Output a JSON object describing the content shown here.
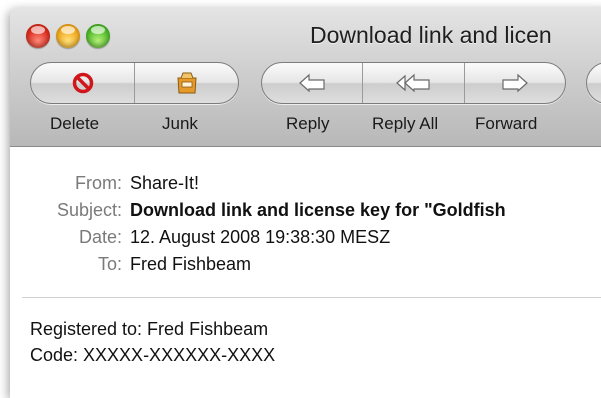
{
  "window": {
    "title": "Download link and licen"
  },
  "toolbar": {
    "delete_label": "Delete",
    "junk_label": "Junk",
    "reply_label": "Reply",
    "reply_all_label": "Reply All",
    "forward_label": "Forward"
  },
  "headers": {
    "from_key": "From:",
    "from_value": "Share-It!",
    "subject_key": "Subject:",
    "subject_value": "Download link and license key for \"Goldfish",
    "date_key": "Date:",
    "date_value": "12. August 2008 19:38:30 MESZ",
    "to_key": "To:",
    "to_value": "Fred Fishbeam"
  },
  "body": {
    "line1": "Registered to: Fred Fishbeam",
    "line2": "Code: XXXXX-XXXXXX-XXXX"
  },
  "colors": {
    "delete_icon": "#d0161a",
    "junk_icon": "#e59a2a",
    "arrow": "#ffffff"
  }
}
